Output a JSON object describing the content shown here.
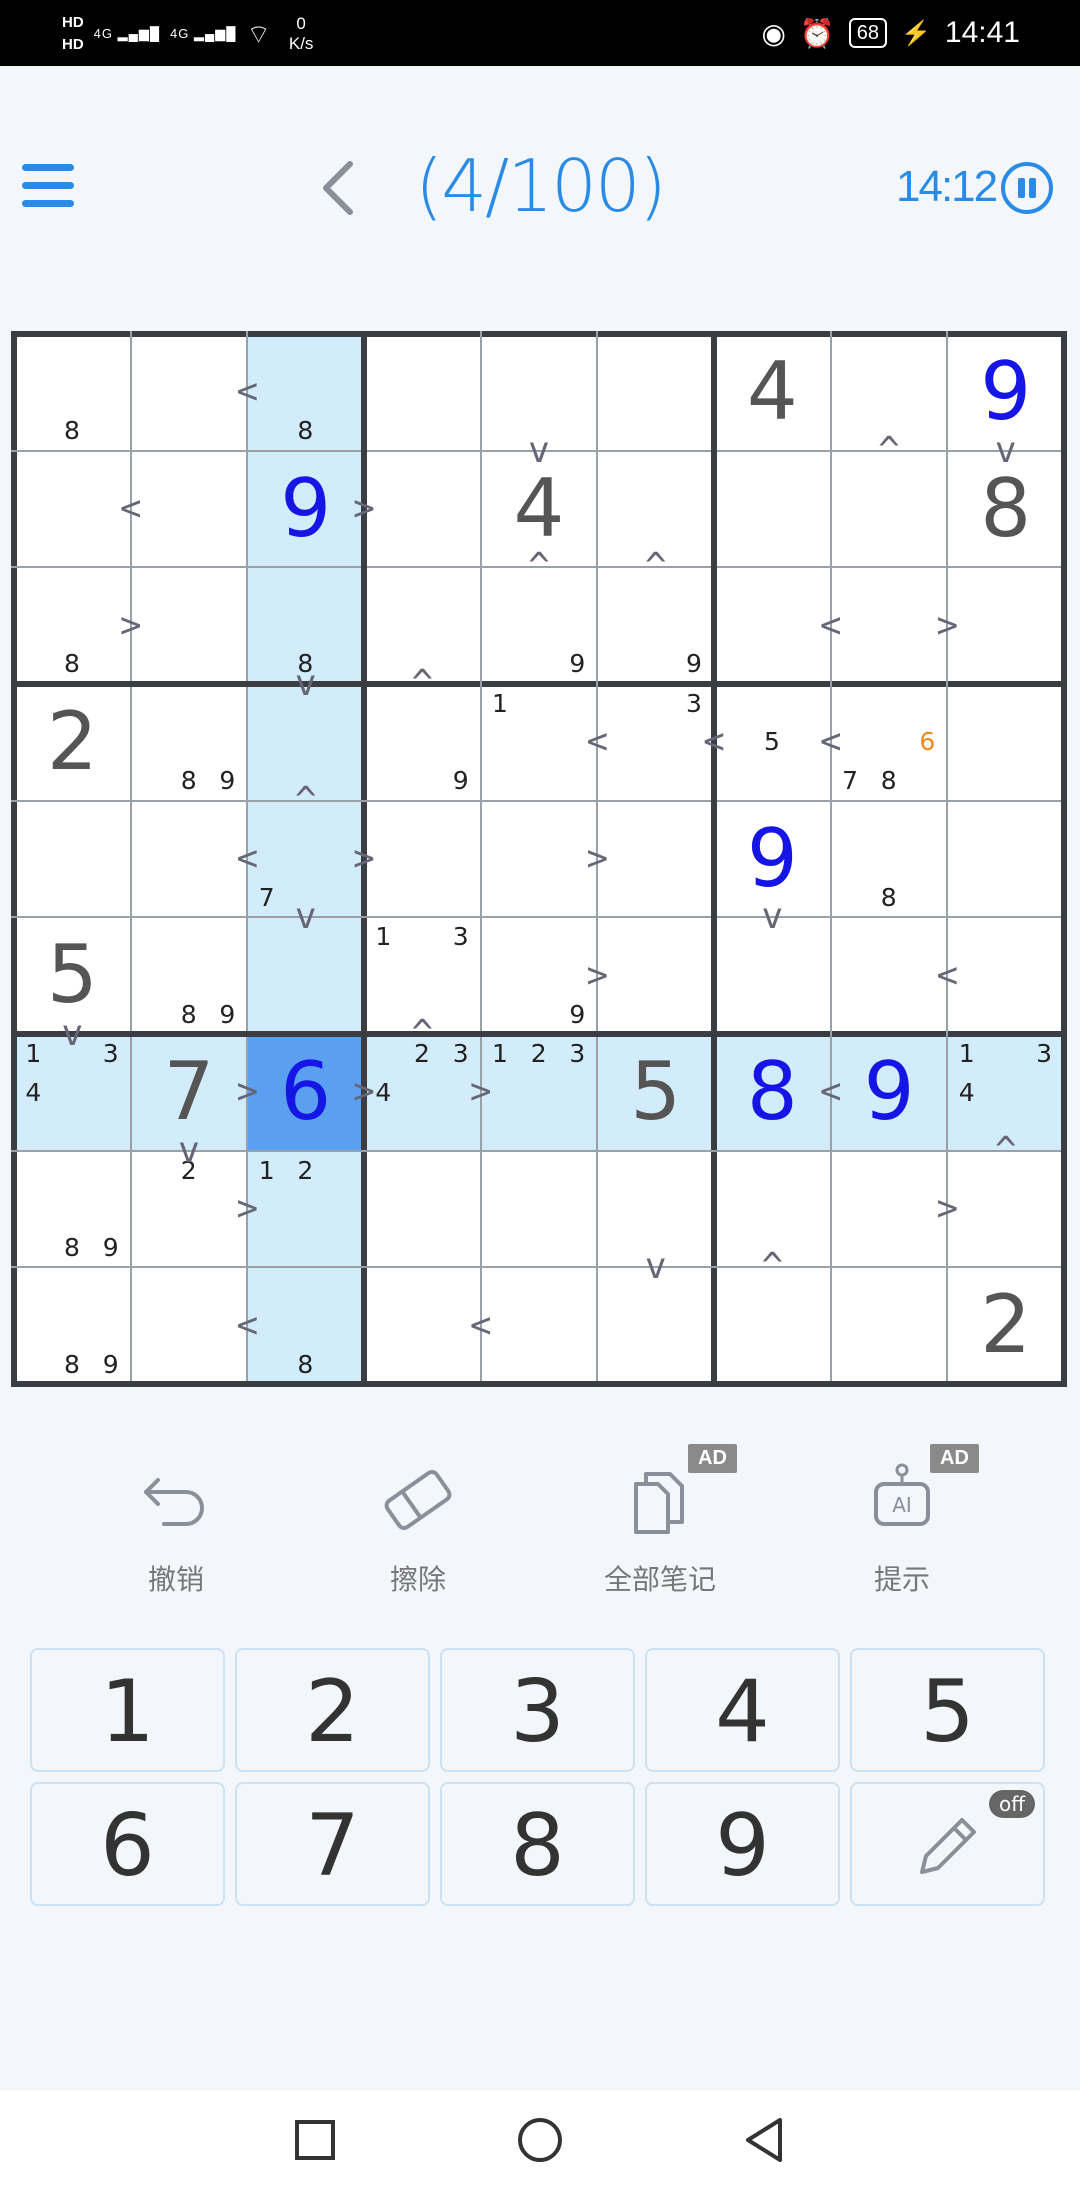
{
  "status": {
    "signal1": "4G",
    "signal2": "4G",
    "speed_value": "0",
    "speed_unit": "K/s",
    "battery": "68",
    "time": "14:41"
  },
  "header": {
    "progress": "(4/100)",
    "timer": "14:12"
  },
  "colors": {
    "accent": "#2a8be6",
    "given": "#555555",
    "user_entry": "#1515e6",
    "highlight": "#d3ecfb",
    "selected": "#5b9ff0",
    "note_orange": "#f08a1c"
  },
  "board": {
    "values": [
      [
        "",
        "",
        "",
        "",
        "",
        "",
        "4",
        "",
        "9"
      ],
      [
        "",
        "",
        "9",
        "",
        "4",
        "",
        "",
        "",
        "8"
      ],
      [
        "",
        "",
        "",
        "",
        "",
        "",
        "",
        "",
        ""
      ],
      [
        "2",
        "",
        "",
        "",
        "",
        "",
        "",
        "",
        ""
      ],
      [
        "",
        "",
        "",
        "",
        "",
        "",
        "9",
        "",
        ""
      ],
      [
        "5",
        "",
        "",
        "",
        "",
        "",
        "",
        "",
        ""
      ],
      [
        "",
        "7",
        "6",
        "",
        "",
        "5",
        "8",
        "9",
        ""
      ],
      [
        "",
        "",
        "",
        "",
        "",
        "",
        "",
        "",
        ""
      ],
      [
        "",
        "",
        "",
        "",
        "",
        "",
        "",
        "",
        "2"
      ]
    ],
    "value_types": [
      [
        "",
        "",
        "",
        "",
        "",
        "",
        "given",
        "",
        "user"
      ],
      [
        "",
        "",
        "user",
        "",
        "given",
        "",
        "",
        "",
        "given"
      ],
      [
        "",
        "",
        "",
        "",
        "",
        "",
        "",
        "",
        ""
      ],
      [
        "given",
        "",
        "",
        "",
        "",
        "",
        "",
        "",
        ""
      ],
      [
        "",
        "",
        "",
        "",
        "",
        "",
        "user",
        "",
        ""
      ],
      [
        "given",
        "",
        "",
        "",
        "",
        "",
        "",
        "",
        ""
      ],
      [
        "",
        "given",
        "user",
        "",
        "",
        "given",
        "user",
        "user",
        ""
      ],
      [
        "",
        "",
        "",
        "",
        "",
        "",
        "",
        "",
        ""
      ],
      [
        "",
        "",
        "",
        "",
        "",
        "",
        "",
        "",
        "given"
      ]
    ],
    "notes": [
      [
        [
          8
        ],
        [],
        [
          8
        ],
        [],
        [],
        [],
        [],
        [],
        []
      ],
      [
        [],
        [],
        [],
        [],
        [],
        [],
        [],
        [],
        []
      ],
      [
        [
          8
        ],
        [],
        [
          8
        ],
        [],
        [
          9
        ],
        [
          9
        ],
        [],
        [],
        []
      ],
      [
        [],
        [
          8,
          9
        ],
        [],
        [
          9
        ],
        [
          1
        ],
        [
          3
        ],
        [
          5
        ],
        [
          6,
          7,
          8
        ],
        []
      ],
      [
        [],
        [],
        [
          7
        ],
        [],
        [],
        [],
        [],
        [
          8
        ],
        []
      ],
      [
        [],
        [
          8,
          9
        ],
        [],
        [
          1,
          3
        ],
        [
          9
        ],
        [],
        [],
        [],
        []
      ],
      [
        [
          1,
          3,
          4
        ],
        [],
        [],
        [
          2,
          3,
          4
        ],
        [
          1,
          2,
          3
        ],
        [],
        [],
        [],
        [
          1,
          3,
          4
        ]
      ],
      [
        [
          8,
          9
        ],
        [
          2
        ],
        [
          1,
          2
        ],
        [],
        [],
        [],
        [],
        [],
        []
      ],
      [
        [
          8,
          9
        ],
        [],
        [
          8
        ],
        [],
        [],
        [],
        [],
        [],
        []
      ]
    ],
    "orange_notes": [
      {
        "row": 3,
        "col": 7,
        "digit": 6
      }
    ],
    "highlight_rows": [
      6
    ],
    "highlight_cols": [
      2
    ],
    "selected": {
      "row": 6,
      "col": 2
    },
    "inequalities_h": [
      {
        "row": 0,
        "col": 1,
        "sym": "<"
      },
      {
        "row": 1,
        "col": 0,
        "sym": "<"
      },
      {
        "row": 1,
        "col": 2,
        "sym": ">"
      },
      {
        "row": 2,
        "col": 0,
        "sym": ">"
      },
      {
        "row": 2,
        "col": 6,
        "sym": "<"
      },
      {
        "row": 2,
        "col": 7,
        "sym": ">"
      },
      {
        "row": 3,
        "col": 4,
        "sym": "<"
      },
      {
        "row": 3,
        "col": 5,
        "sym": "<"
      },
      {
        "row": 3,
        "col": 6,
        "sym": "<"
      },
      {
        "row": 4,
        "col": 1,
        "sym": "<"
      },
      {
        "row": 4,
        "col": 2,
        "sym": ">"
      },
      {
        "row": 4,
        "col": 4,
        "sym": ">"
      },
      {
        "row": 5,
        "col": 4,
        "sym": ">"
      },
      {
        "row": 5,
        "col": 7,
        "sym": "<"
      },
      {
        "row": 6,
        "col": 1,
        "sym": ">"
      },
      {
        "row": 6,
        "col": 2,
        "sym": ">"
      },
      {
        "row": 6,
        "col": 3,
        "sym": ">"
      },
      {
        "row": 6,
        "col": 6,
        "sym": "<"
      },
      {
        "row": 7,
        "col": 1,
        "sym": ">"
      },
      {
        "row": 7,
        "col": 7,
        "sym": ">"
      },
      {
        "row": 8,
        "col": 1,
        "sym": "<"
      },
      {
        "row": 8,
        "col": 3,
        "sym": "<"
      }
    ],
    "inequalities_v": [
      {
        "row": 0,
        "col": 4,
        "sym": "v"
      },
      {
        "row": 0,
        "col": 7,
        "sym": "^"
      },
      {
        "row": 0,
        "col": 8,
        "sym": "v"
      },
      {
        "row": 1,
        "col": 4,
        "sym": "^"
      },
      {
        "row": 1,
        "col": 5,
        "sym": "^"
      },
      {
        "row": 2,
        "col": 2,
        "sym": "v"
      },
      {
        "row": 2,
        "col": 3,
        "sym": "^"
      },
      {
        "row": 3,
        "col": 2,
        "sym": "^"
      },
      {
        "row": 4,
        "col": 2,
        "sym": "v"
      },
      {
        "row": 4,
        "col": 6,
        "sym": "v"
      },
      {
        "row": 5,
        "col": 0,
        "sym": "v"
      },
      {
        "row": 5,
        "col": 3,
        "sym": "^"
      },
      {
        "row": 6,
        "col": 1,
        "sym": "v"
      },
      {
        "row": 6,
        "col": 8,
        "sym": "^"
      },
      {
        "row": 7,
        "col": 5,
        "sym": "v"
      },
      {
        "row": 7,
        "col": 6,
        "sym": "^"
      }
    ]
  },
  "tools": {
    "undo": "撤销",
    "erase": "擦除",
    "all_notes": "全部笔记",
    "hint": "提示",
    "ad_label": "AD"
  },
  "keypad": {
    "keys": [
      "1",
      "2",
      "3",
      "4",
      "5",
      "6",
      "7",
      "8",
      "9"
    ],
    "pencil_state": "off"
  }
}
